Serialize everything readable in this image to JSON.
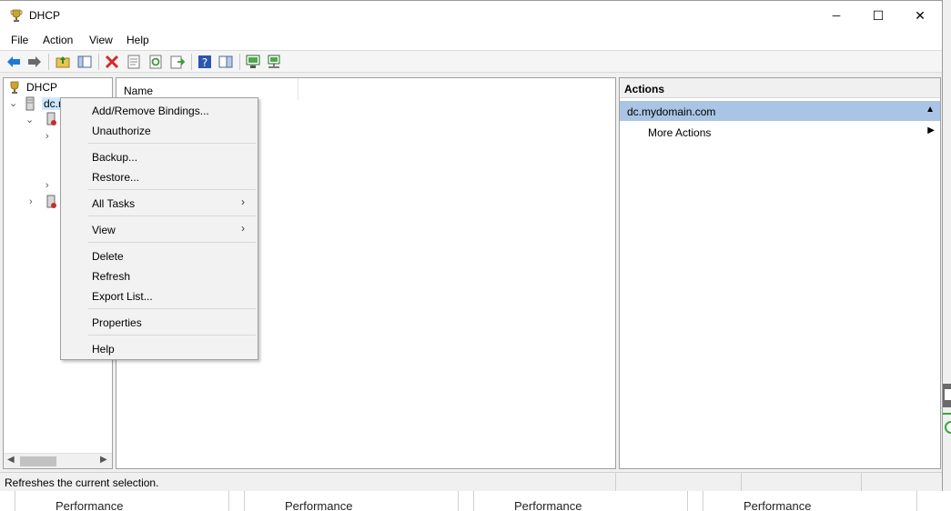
{
  "window": {
    "title": "DHCP",
    "minimize": "─",
    "maximize": "☐",
    "close": "✕"
  },
  "menu": [
    "File",
    "Action",
    "View",
    "Help"
  ],
  "tree": {
    "root": "DHCP",
    "server": "dc.r"
  },
  "list": {
    "column_name": "Name"
  },
  "actions": {
    "title": "Actions",
    "section": "dc.mydomain.com",
    "more": "More Actions"
  },
  "context_menu": {
    "items": [
      {
        "label": "Add/Remove Bindings..."
      },
      {
        "label": "Unauthorize"
      },
      {
        "label": "Backup..."
      },
      {
        "label": "Restore..."
      },
      {
        "label": "All Tasks",
        "submenu": "›"
      },
      {
        "label": "View",
        "submenu": "›"
      },
      {
        "label": "Delete"
      },
      {
        "label": "Refresh"
      },
      {
        "label": "Export List..."
      },
      {
        "label": "Properties"
      },
      {
        "label": "Help"
      }
    ]
  },
  "status": {
    "text": "Refreshes the current selection."
  },
  "taskstrip": [
    "Performance",
    "Performance",
    "Performance",
    "Performance"
  ],
  "colors": {
    "selection": "#cce8ff",
    "actions_section": "#a9c4e4",
    "delete_red": "#d42a2a",
    "nav_blue": "#1e78d7",
    "nav_green": "#3a9a3a"
  },
  "icons": {
    "app": "dhcp-trophy-icon",
    "back": "back-arrow-icon",
    "forward": "forward-arrow-icon"
  }
}
